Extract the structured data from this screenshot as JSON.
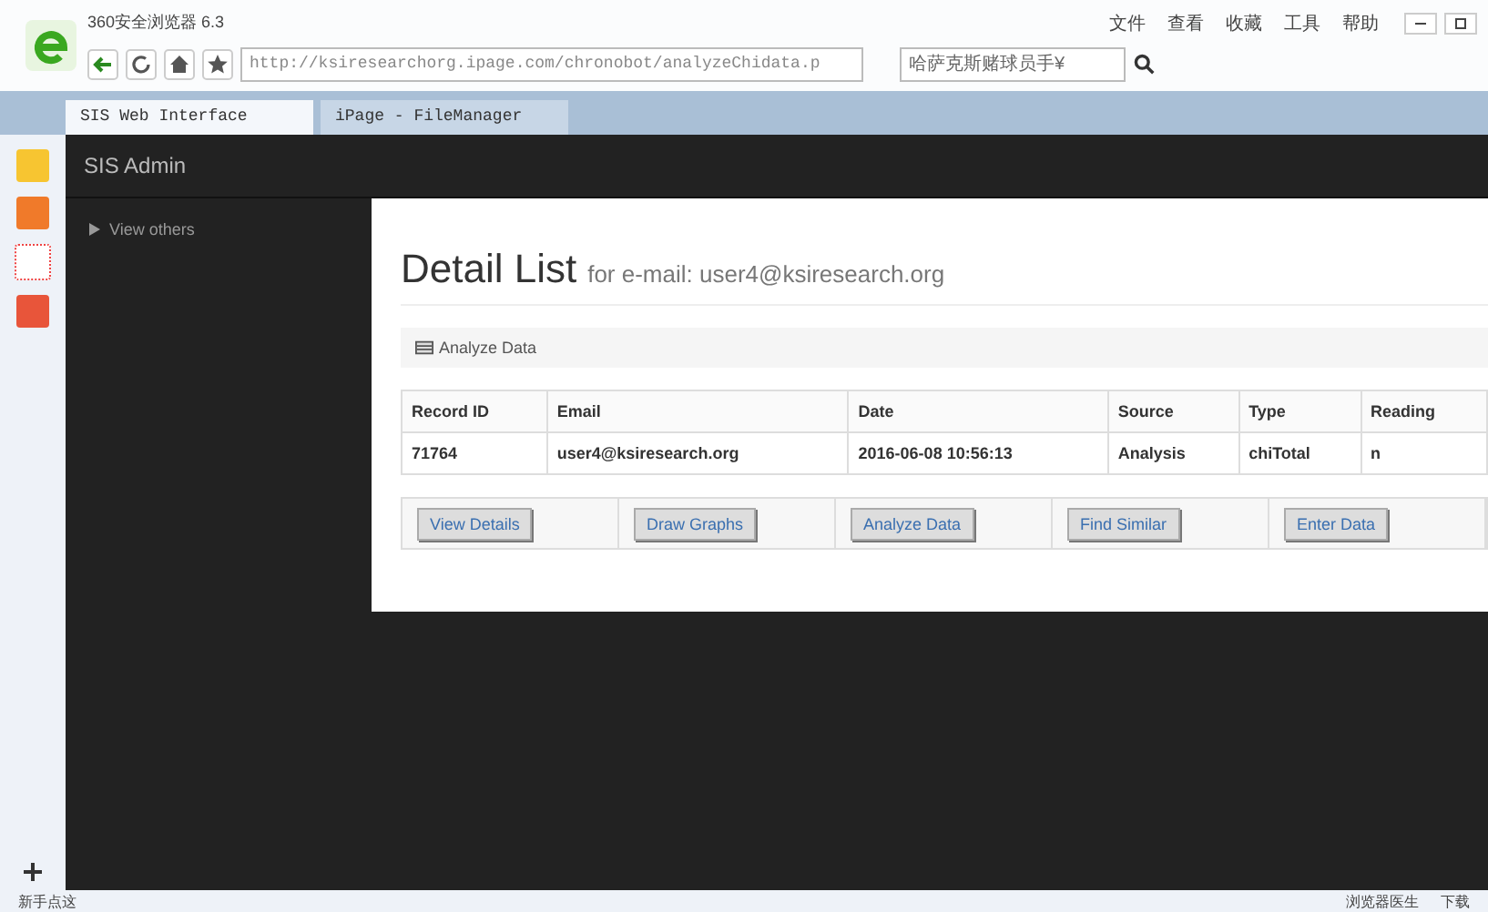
{
  "browser": {
    "name": "360安全浏览器 6.3",
    "url": "http://ksiresearchorg.ipage.com/chronobot/analyzeChidata.p",
    "search": "哈萨克斯赌球员手¥",
    "menu": [
      "文件",
      "查看",
      "收藏",
      "工具",
      "帮助"
    ]
  },
  "tabs": [
    {
      "label": "SIS Web Interface",
      "selected": true
    },
    {
      "label": "iPage - FileManager",
      "selected": false
    }
  ],
  "navbar": {
    "brand": "SIS Admin"
  },
  "sidebar": {
    "items": [
      {
        "label": "View others",
        "expanded": false
      }
    ]
  },
  "page": {
    "title": "Detail List",
    "subtitle": "for e-mail: user4@ksiresearch.org",
    "panel": "Analyze Data",
    "table": {
      "columns": [
        "Record ID",
        "Email",
        "Date",
        "Source",
        "Type",
        "Reading"
      ],
      "rows": [
        [
          "71764",
          "user4@ksiresearch.org",
          "2016-06-08 10:56:13",
          "Analysis",
          "chiTotal",
          "n"
        ]
      ]
    },
    "buttons": [
      "View Details",
      "Draw Graphs",
      "Analyze Data",
      "Find Similar",
      "Enter Data"
    ]
  },
  "status_bar": {
    "left": "新手点这",
    "right": [
      "浏览器医生",
      "下载"
    ]
  }
}
